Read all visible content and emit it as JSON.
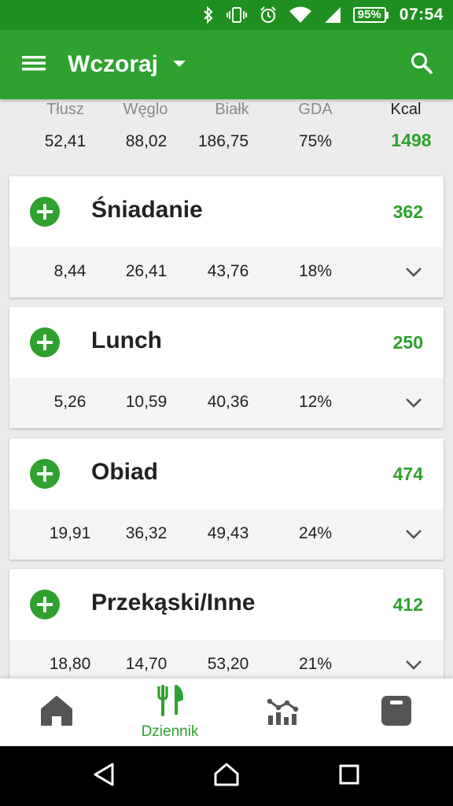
{
  "status_bar": {
    "battery": "95%",
    "time": "07:54"
  },
  "app_bar": {
    "title": "Wczoraj"
  },
  "summary": {
    "labels": [
      "Tłusz",
      "Węglo",
      "Białk",
      "GDA",
      "Kcal"
    ],
    "values": [
      "52,41",
      "88,02",
      "186,75",
      "75%",
      "1498"
    ]
  },
  "meals": [
    {
      "name": "Śniadanie",
      "kcal": "362",
      "fat": "8,44",
      "carbs": "26,41",
      "protein": "43,76",
      "gda": "18%"
    },
    {
      "name": "Lunch",
      "kcal": "250",
      "fat": "5,26",
      "carbs": "10,59",
      "protein": "40,36",
      "gda": "12%"
    },
    {
      "name": "Obiad",
      "kcal": "474",
      "fat": "19,91",
      "carbs": "36,32",
      "protein": "49,43",
      "gda": "24%"
    },
    {
      "name": "Przekąski/Inne",
      "kcal": "412",
      "fat": "18,80",
      "carbs": "14,70",
      "protein": "53,20",
      "gda": "21%"
    }
  ],
  "bottom_nav": {
    "items": [
      {
        "icon": "home-icon",
        "label": ""
      },
      {
        "icon": "cutlery-icon",
        "label": "Dziennik"
      },
      {
        "icon": "progress-chart-icon",
        "label": ""
      },
      {
        "icon": "scale-icon",
        "label": ""
      }
    ]
  },
  "colors": {
    "status_bar": "#1f8f1f",
    "app_bar": "#2ea12e",
    "accent": "#2ea12e",
    "background": "#ececec"
  }
}
